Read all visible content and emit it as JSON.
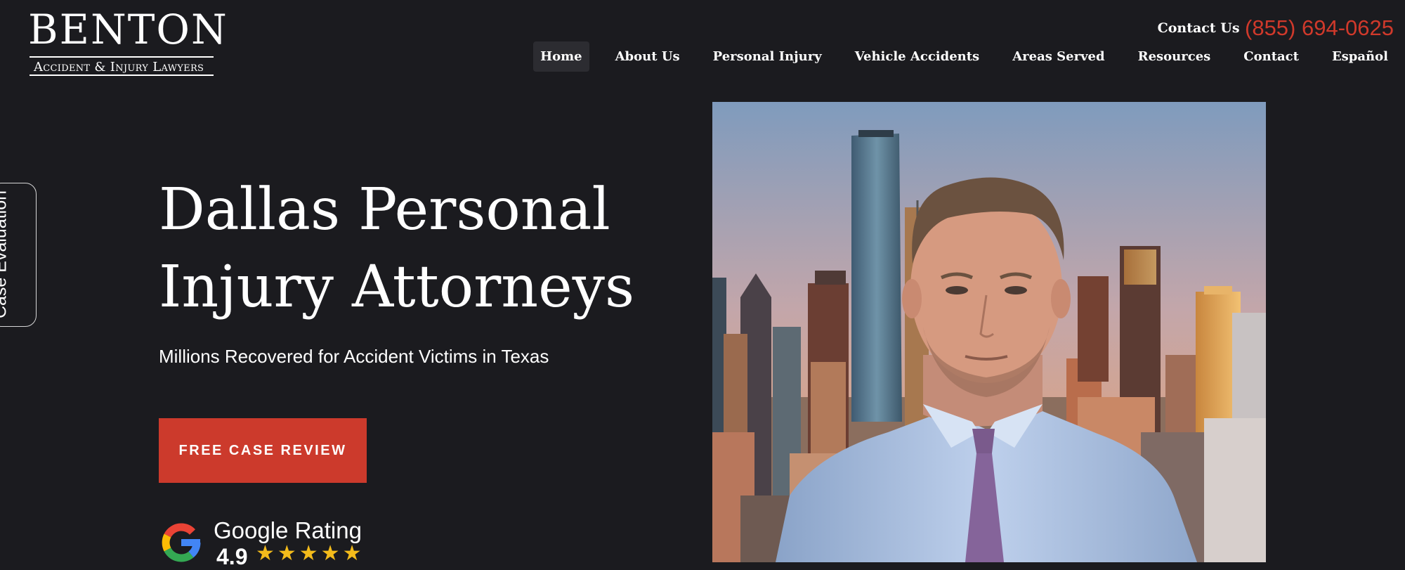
{
  "logo": {
    "name": "BENTON",
    "subtitle": "Accident & Injury Lawyers"
  },
  "contact": {
    "label": "Contact Us",
    "phone": "(855) 694-0625"
  },
  "nav": {
    "items": [
      {
        "label": "Home",
        "active": true
      },
      {
        "label": "About Us"
      },
      {
        "label": "Personal Injury"
      },
      {
        "label": "Vehicle Accidents"
      },
      {
        "label": "Areas Served"
      },
      {
        "label": "Resources"
      },
      {
        "label": "Contact"
      },
      {
        "label": "Español"
      }
    ]
  },
  "side_tab": {
    "label": "Case Evaluation"
  },
  "hero": {
    "headline_line1": "Dallas Personal",
    "headline_line2": "Injury Attorneys",
    "subheadline": "Millions Recovered for Accident Victims in Texas",
    "cta_label": "FREE CASE REVIEW"
  },
  "rating": {
    "label": "Google Rating",
    "score": "4.9",
    "stars": "★★★★★"
  },
  "icons": {
    "google": "google-g-icon",
    "star": "star-icon"
  },
  "colors": {
    "background": "#1b1b1f",
    "accent_red": "#cc3a2c",
    "phone_red": "#d0392b",
    "star_gold": "#f3bb1b",
    "text": "#ffffff"
  }
}
